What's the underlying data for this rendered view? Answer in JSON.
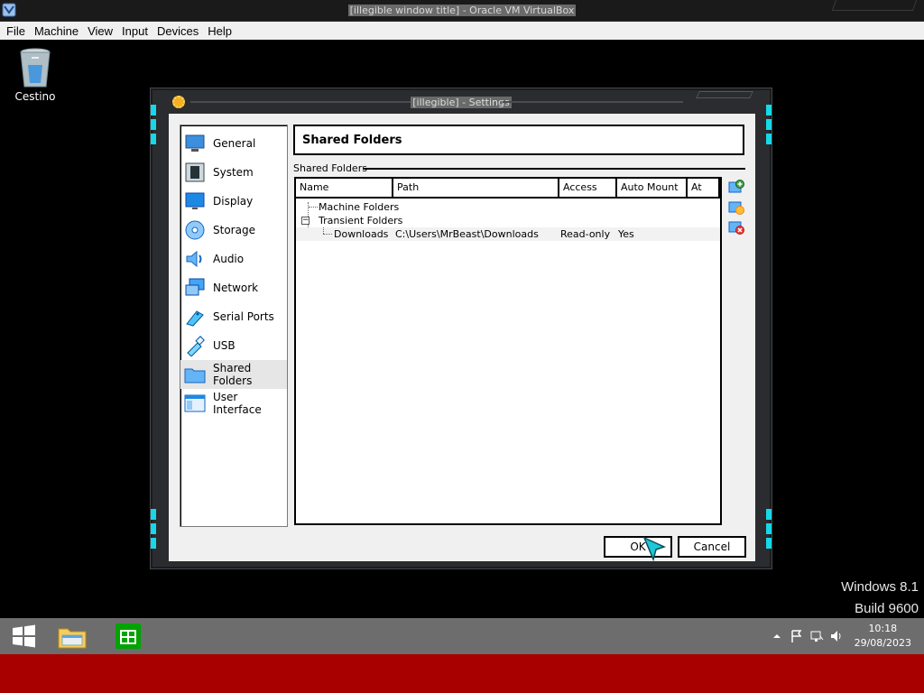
{
  "host": {
    "title": "[illegible window title] - Oracle VM VirtualBox",
    "menu": [
      "File",
      "Machine",
      "View",
      "Input",
      "Devices",
      "Help"
    ]
  },
  "desktop": {
    "recycle_bin_label": "Cestino",
    "watermark_line1": "Windows 8.1",
    "watermark_line2": "Build 9600"
  },
  "dialog": {
    "title": "[illegible] - Settings",
    "sidebar": [
      {
        "label": "General",
        "icon": "general-icon"
      },
      {
        "label": "System",
        "icon": "system-icon"
      },
      {
        "label": "Display",
        "icon": "display-icon"
      },
      {
        "label": "Storage",
        "icon": "storage-icon"
      },
      {
        "label": "Audio",
        "icon": "audio-icon"
      },
      {
        "label": "Network",
        "icon": "network-icon"
      },
      {
        "label": "Serial Ports",
        "icon": "serial-ports-icon"
      },
      {
        "label": "USB",
        "icon": "usb-icon"
      },
      {
        "label": "Shared Folders",
        "icon": "shared-folders-icon",
        "selected": true
      },
      {
        "label": "User Interface",
        "icon": "user-interface-icon"
      }
    ],
    "page_title": "Shared Folders",
    "group_label": "Shared Folders",
    "columns": [
      "Name",
      "Path",
      "Access",
      "Auto Mount",
      "At"
    ],
    "tree": {
      "machine_folders": "Machine Folders",
      "transient_folders": "Transient Folders",
      "rows": [
        {
          "name": "Downloads",
          "path": "C:\\Users\\MrBeast\\Downloads",
          "access": "Read-only",
          "auto_mount": "Yes",
          "at": ""
        }
      ]
    },
    "tool_buttons": [
      "add-shared-folder-icon",
      "edit-shared-folder-icon",
      "remove-shared-folder-icon"
    ],
    "ok_label": "OK",
    "cancel_label": "Cancel"
  },
  "taskbar": {
    "time": "10:18",
    "date": "29/08/2023"
  }
}
